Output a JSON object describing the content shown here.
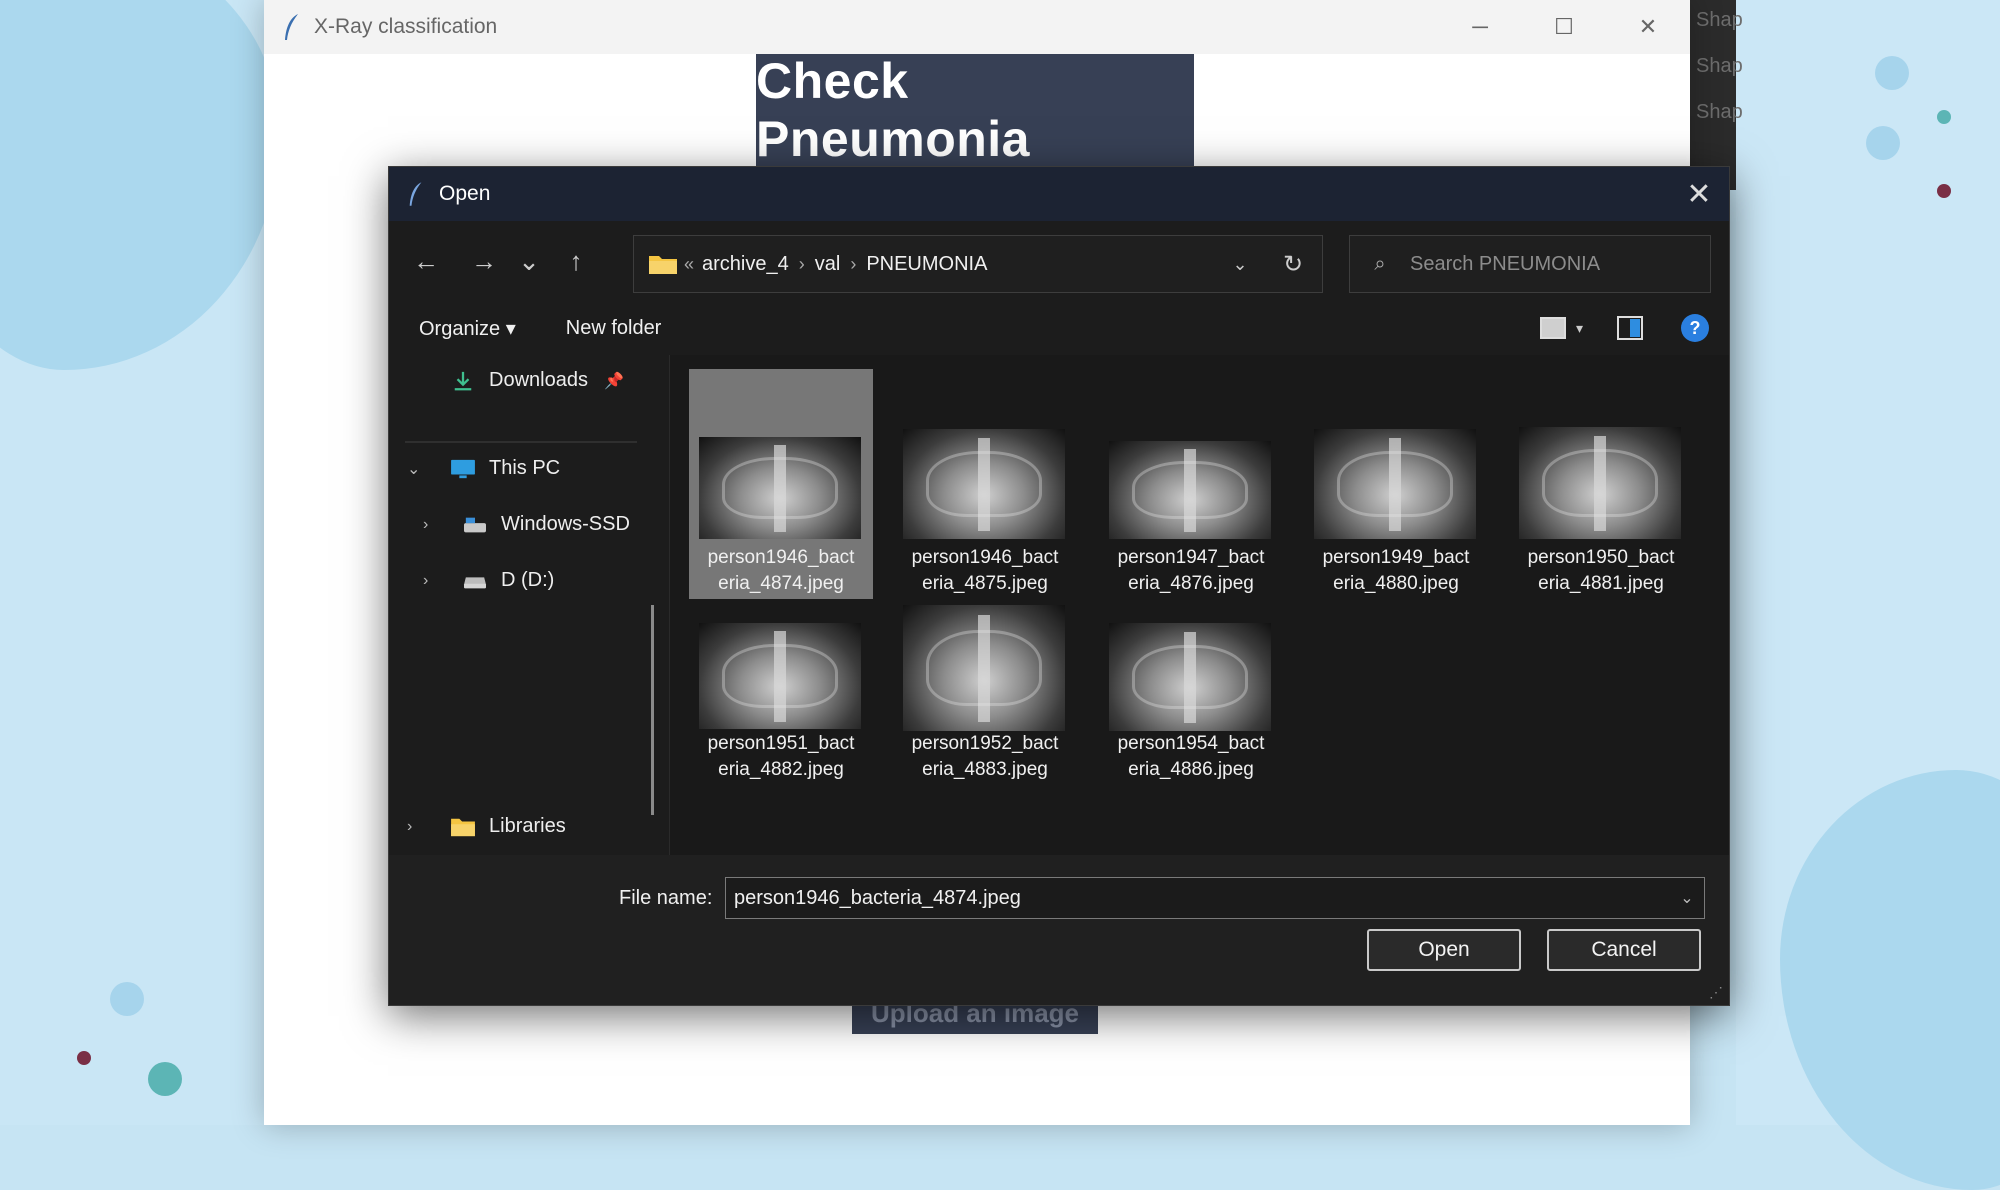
{
  "colors": {
    "background": "#c6e4f3",
    "banner": "#374055",
    "dialog_bg": "#202020",
    "dialog_titlebar": "#1c2333",
    "selection": "#777777",
    "accent": "#2a7fe0"
  },
  "background_app": {
    "lines": [
      "Shap",
      "Shap",
      "Shap"
    ]
  },
  "main_window": {
    "title": "X-Ray classification",
    "controls": {
      "minimize": "─",
      "maximize": "☐",
      "close": "✕"
    },
    "banner_text": "Check Pneumonia",
    "upload_button": "Upload an image"
  },
  "dialog": {
    "title": "Open",
    "close": "✕",
    "nav": {
      "back": "←",
      "forward": "→",
      "recent": "⌄",
      "up": "↑"
    },
    "address": {
      "overflow": "«",
      "crumbs": [
        "archive_4",
        "val",
        "PNEUMONIA"
      ],
      "separator": "›",
      "dropdown": "⌄",
      "refresh": "↻"
    },
    "search": {
      "icon": "⌕",
      "placeholder": "Search PNEUMONIA"
    },
    "commands": {
      "organize": "Organize ▾",
      "new_folder": "New folder",
      "view_dropdown": "▾",
      "help": "?"
    },
    "nav_pane": {
      "quick_access": {
        "label": "Downloads",
        "pin": "📌"
      },
      "this_pc": {
        "arrow": "⌄",
        "label": "This PC"
      },
      "drives": [
        {
          "arrow": "›",
          "label": "Windows-SSD"
        },
        {
          "arrow": "›",
          "label": "D (D:)"
        }
      ],
      "libraries": {
        "arrow": "›",
        "label": "Libraries"
      }
    },
    "files": [
      {
        "line1": "person1946_bact",
        "line2": "eria_4874.jpeg",
        "selected": true
      },
      {
        "line1": "person1946_bact",
        "line2": "eria_4875.jpeg",
        "selected": false
      },
      {
        "line1": "person1947_bact",
        "line2": "eria_4876.jpeg",
        "selected": false
      },
      {
        "line1": "person1949_bact",
        "line2": "eria_4880.jpeg",
        "selected": false
      },
      {
        "line1": "person1950_bact",
        "line2": "eria_4881.jpeg",
        "selected": false
      },
      {
        "line1": "person1951_bact",
        "line2": "eria_4882.jpeg",
        "selected": false
      },
      {
        "line1": "person1952_bact",
        "line2": "eria_4883.jpeg",
        "selected": false
      },
      {
        "line1": "person1954_bact",
        "line2": "eria_4886.jpeg",
        "selected": false
      }
    ],
    "file_name_label": "File name:",
    "file_name_value": "person1946_bacteria_4874.jpeg",
    "file_name_dropdown": "⌄",
    "open_button": "Open",
    "cancel_button": "Cancel",
    "resize_grip": "⋰"
  }
}
